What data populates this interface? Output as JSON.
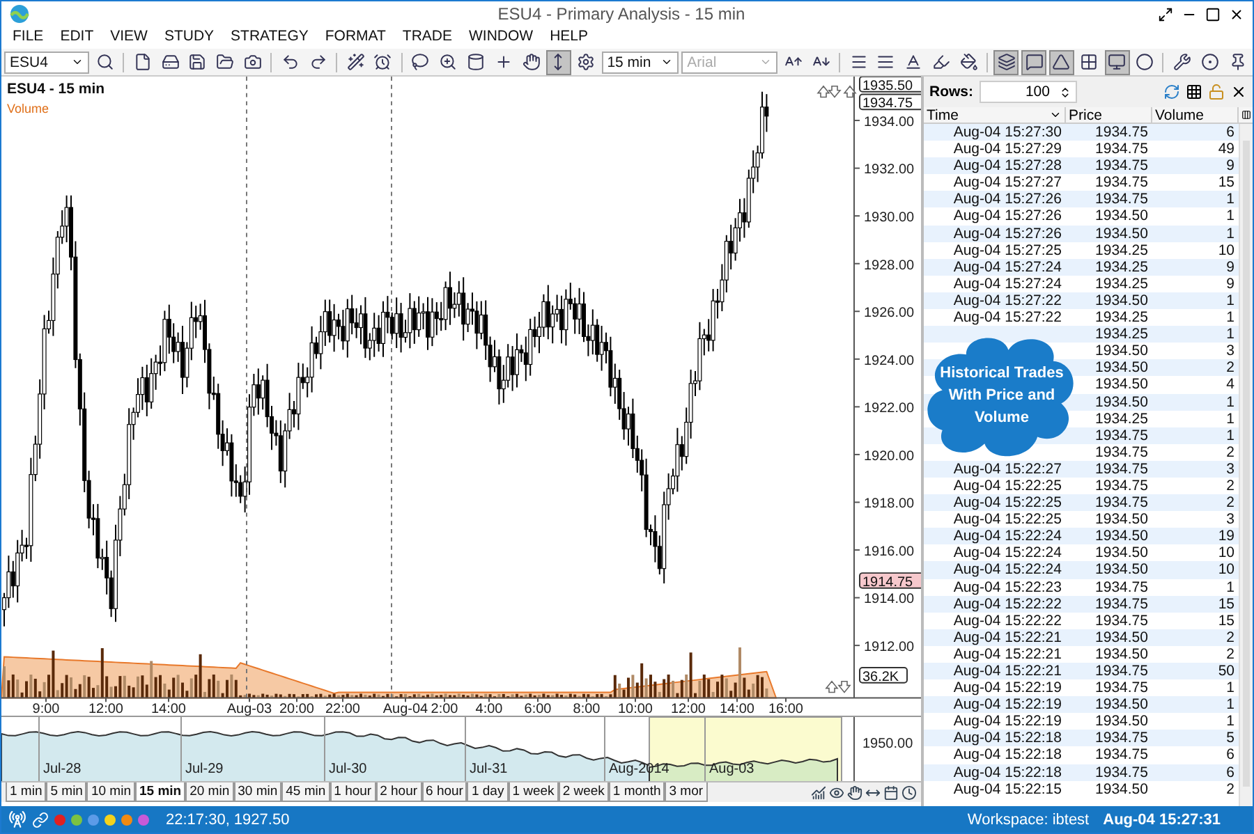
{
  "window": {
    "title": "ESU4 - Primary Analysis - 15 min"
  },
  "menu": [
    "FILE",
    "EDIT",
    "VIEW",
    "STUDY",
    "STRATEGY",
    "FORMAT",
    "TRADE",
    "WINDOW",
    "HELP"
  ],
  "toolbar": {
    "symbol": "ESU4",
    "interval": "15 min",
    "font": {
      "value": "Arial",
      "disabled": true
    },
    "tools": [
      {
        "kind": "search",
        "active": false
      },
      {
        "kind": "sep"
      },
      {
        "kind": "new",
        "active": false
      },
      {
        "kind": "disk",
        "active": false
      },
      {
        "kind": "save",
        "active": false
      },
      {
        "kind": "open",
        "active": false
      },
      {
        "kind": "camera",
        "active": false
      },
      {
        "kind": "sep"
      },
      {
        "kind": "undo",
        "active": false
      },
      {
        "kind": "redo",
        "active": false
      },
      {
        "kind": "sep"
      },
      {
        "kind": "wand",
        "active": false
      },
      {
        "kind": "alarm",
        "active": false
      },
      {
        "kind": "sep"
      },
      {
        "kind": "lasso",
        "active": false
      },
      {
        "kind": "zoom",
        "active": false
      },
      {
        "kind": "candle",
        "active": false
      },
      {
        "kind": "cross",
        "active": false
      },
      {
        "kind": "hand",
        "active": false
      },
      {
        "kind": "fit",
        "active": true
      },
      {
        "kind": "gear",
        "active": false
      }
    ],
    "tools2": [
      {
        "kind": "grow",
        "active": false
      },
      {
        "kind": "shrink",
        "active": false
      },
      {
        "kind": "sep"
      },
      {
        "kind": "weight",
        "active": false
      },
      {
        "kind": "style",
        "active": false
      },
      {
        "kind": "textcolor",
        "active": false
      },
      {
        "kind": "pen",
        "active": false
      },
      {
        "kind": "bucket",
        "active": false
      },
      {
        "kind": "sep"
      },
      {
        "kind": "layers",
        "active": true
      },
      {
        "kind": "chat",
        "active": true
      },
      {
        "kind": "angle",
        "active": true
      },
      {
        "kind": "grid",
        "active": false
      },
      {
        "kind": "monitor",
        "active": true
      },
      {
        "kind": "circle",
        "active": false
      },
      {
        "kind": "sep"
      },
      {
        "kind": "tools",
        "active": false
      },
      {
        "kind": "record",
        "active": false
      },
      {
        "kind": "pin",
        "active": false
      }
    ]
  },
  "chart": {
    "title": "ESU4 - 15 min",
    "study": "Volume",
    "price_ticks": [
      "1934.00",
      "1932.00",
      "1930.00",
      "1928.00",
      "1926.00",
      "1924.00",
      "1922.00",
      "1920.00",
      "1918.00",
      "1916.00",
      "1914.00",
      "1912.00"
    ],
    "markers": [
      {
        "text": "1935.50",
        "kind": "high"
      },
      {
        "text": "1934.75",
        "kind": "last"
      },
      {
        "text": "1914.75",
        "kind": "low"
      },
      {
        "text": "36.2K",
        "kind": "volume"
      }
    ],
    "time_axis": [
      "9:00",
      "12:00",
      "14:00",
      "Aug-03",
      "20:00",
      "22:00",
      "Aug-04",
      "2:00",
      "4:00",
      "6:00",
      "8:00",
      "10:00",
      "12:00",
      "14:00",
      "16:00"
    ]
  },
  "overview": {
    "dates": [
      "Jul-28",
      "Jul-29",
      "Jul-30",
      "Jul-31",
      "Aug-2014",
      "Aug-03"
    ],
    "price": "1950.00"
  },
  "intervals": [
    {
      "label": "1 min",
      "selected": false
    },
    {
      "label": "5 min",
      "selected": false
    },
    {
      "label": "10 min",
      "selected": false
    },
    {
      "label": "15 min",
      "selected": true
    },
    {
      "label": "20 min",
      "selected": false
    },
    {
      "label": "30 min",
      "selected": false
    },
    {
      "label": "45 min",
      "selected": false
    },
    {
      "label": "1 hour",
      "selected": false
    },
    {
      "label": "2 hour",
      "selected": false
    },
    {
      "label": "6 hour",
      "selected": false
    },
    {
      "label": "1 day",
      "selected": false
    },
    {
      "label": "1 week",
      "selected": false
    },
    {
      "label": "2 week",
      "selected": false
    },
    {
      "label": "1 month",
      "selected": false
    },
    {
      "label": "3 mor",
      "selected": false
    }
  ],
  "trades": {
    "rows_label": "Rows:",
    "rows_value": "100",
    "columns": [
      "Time",
      "Price",
      "Volume"
    ],
    "rows": [
      {
        "time": "Aug-04  15:27:30",
        "price": "1934.75",
        "volume": "6"
      },
      {
        "time": "Aug-04  15:27:29",
        "price": "1934.75",
        "volume": "49"
      },
      {
        "time": "Aug-04  15:27:28",
        "price": "1934.75",
        "volume": "9"
      },
      {
        "time": "Aug-04  15:27:27",
        "price": "1934.75",
        "volume": "15"
      },
      {
        "time": "Aug-04  15:27:26",
        "price": "1934.75",
        "volume": "1"
      },
      {
        "time": "Aug-04  15:27:26",
        "price": "1934.50",
        "volume": "1"
      },
      {
        "time": "Aug-04  15:27:26",
        "price": "1934.50",
        "volume": "1"
      },
      {
        "time": "Aug-04  15:27:25",
        "price": "1934.25",
        "volume": "10"
      },
      {
        "time": "Aug-04  15:27:24",
        "price": "1934.25",
        "volume": "9"
      },
      {
        "time": "Aug-04  15:27:24",
        "price": "1934.25",
        "volume": "9"
      },
      {
        "time": "Aug-04  15:27:22",
        "price": "1934.50",
        "volume": "1"
      },
      {
        "time": "Aug-04  15:27:22",
        "price": "1934.25",
        "volume": "1"
      },
      {
        "price": "1934.25",
        "volume": "1"
      },
      {
        "price": "1934.50",
        "volume": "3"
      },
      {
        "price": "1934.50",
        "volume": "2"
      },
      {
        "price": "1934.50",
        "volume": "4"
      },
      {
        "price": "1934.50",
        "volume": "1"
      },
      {
        "price": "1934.25",
        "volume": "1"
      },
      {
        "price": "1934.75",
        "volume": "1"
      },
      {
        "price": "1934.75",
        "volume": "2"
      },
      {
        "time": "Aug-04  15:22:27",
        "price": "1934.75",
        "volume": "3"
      },
      {
        "time": "Aug-04  15:22:25",
        "price": "1934.75",
        "volume": "2"
      },
      {
        "time": "Aug-04  15:22:25",
        "price": "1934.75",
        "volume": "2"
      },
      {
        "time": "Aug-04  15:22:25",
        "price": "1934.50",
        "volume": "3"
      },
      {
        "time": "Aug-04  15:22:24",
        "price": "1934.50",
        "volume": "19"
      },
      {
        "time": "Aug-04  15:22:24",
        "price": "1934.50",
        "volume": "10"
      },
      {
        "time": "Aug-04  15:22:24",
        "price": "1934.50",
        "volume": "10"
      },
      {
        "time": "Aug-04  15:22:23",
        "price": "1934.75",
        "volume": "1"
      },
      {
        "time": "Aug-04  15:22:22",
        "price": "1934.75",
        "volume": "15"
      },
      {
        "time": "Aug-04  15:22:22",
        "price": "1934.75",
        "volume": "15"
      },
      {
        "time": "Aug-04  15:22:21",
        "price": "1934.50",
        "volume": "2"
      },
      {
        "time": "Aug-04  15:22:21",
        "price": "1934.50",
        "volume": "2"
      },
      {
        "time": "Aug-04  15:22:21",
        "price": "1934.75",
        "volume": "50"
      },
      {
        "time": "Aug-04  15:22:19",
        "price": "1934.75",
        "volume": "1"
      },
      {
        "time": "Aug-04  15:22:19",
        "price": "1934.50",
        "volume": "1"
      },
      {
        "time": "Aug-04  15:22:19",
        "price": "1934.50",
        "volume": "1"
      },
      {
        "time": "Aug-04  15:22:18",
        "price": "1934.75",
        "volume": "5"
      },
      {
        "time": "Aug-04  15:22:18",
        "price": "1934.75",
        "volume": "6"
      },
      {
        "time": "Aug-04  15:22:18",
        "price": "1934.75",
        "volume": "6"
      },
      {
        "time": "Aug-04  15:22:15",
        "price": "1934.50",
        "volume": "2"
      }
    ]
  },
  "callout": "Historical Trades With Price and Volume",
  "status_bar": {
    "dots": [
      {
        "color": "#e02020"
      },
      {
        "color": "#7cc242"
      },
      {
        "color": "#5b9be8"
      },
      {
        "color": "#f4d21c"
      },
      {
        "color": "#f08a12"
      },
      {
        "color": "#c85ad8"
      }
    ],
    "cursor": "22:17:30, 1927.50",
    "workspace": "Workspace: ibtest",
    "time": "Aug-04 15:27:31"
  }
}
